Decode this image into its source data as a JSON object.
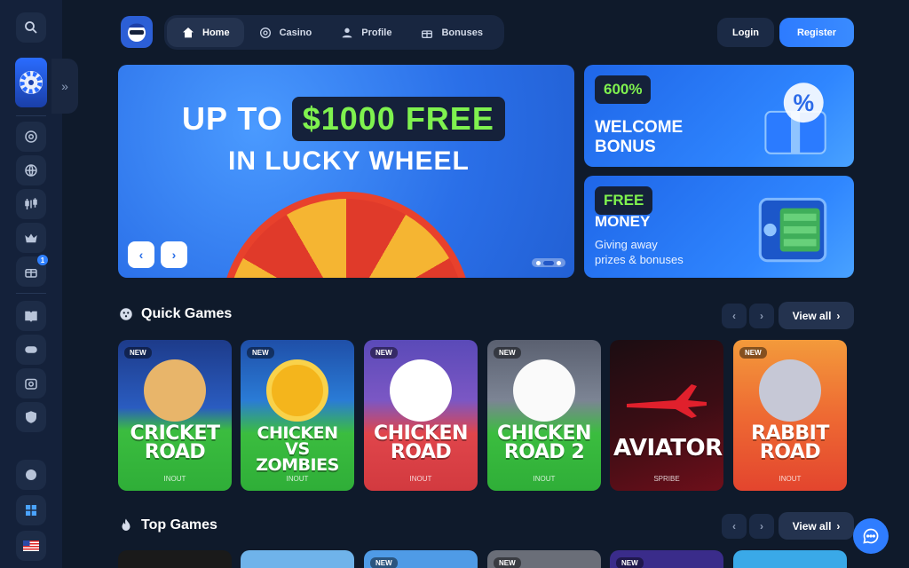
{
  "header": {
    "nav": [
      {
        "label": "Home",
        "icon": "home-icon",
        "active": true
      },
      {
        "label": "Casino",
        "icon": "casino-chip-icon",
        "active": false
      },
      {
        "label": "Profile",
        "icon": "user-icon",
        "active": false
      },
      {
        "label": "Bonuses",
        "icon": "gift-icon",
        "active": false
      }
    ],
    "login_label": "Login",
    "register_label": "Register"
  },
  "sidebar": {
    "notification_count": "1"
  },
  "hero": {
    "line1_prefix": "UP TO",
    "line1_highlight": "$1000 FREE",
    "line2": "IN LUCKY WHEEL"
  },
  "promos": [
    {
      "tag": "600%",
      "title_line1": "WELCOME",
      "title_line2": "BONUS"
    },
    {
      "tag": "FREE",
      "title_line1": "MONEY",
      "subtitle_line1": "Giving away",
      "subtitle_line2": "prizes & bonuses"
    }
  ],
  "quick_games": {
    "title": "Quick Games",
    "view_all": "View all",
    "games": [
      {
        "title_line1": "CRICKET",
        "title_line2": "ROAD",
        "provider": "INOUT",
        "new": "NEW"
      },
      {
        "title_line1": "CHICKEN",
        "title_line2": "VS ZOMBIES",
        "provider": "INOUT",
        "new": "NEW"
      },
      {
        "title_line1": "CHICKEN",
        "title_line2": "ROAD",
        "provider": "INOUT",
        "new": "NEW"
      },
      {
        "title_line1": "CHICKEN",
        "title_line2": "ROAD 2",
        "provider": "INOUT",
        "new": "NEW"
      },
      {
        "title_line1": "AVIATOR",
        "title_line2": "",
        "provider": "SPRIBE",
        "new": ""
      },
      {
        "title_line1": "RABBIT",
        "title_line2": "ROAD",
        "provider": "INOUT",
        "new": "NEW"
      }
    ]
  },
  "top_games": {
    "title": "Top Games",
    "view_all": "View all",
    "new_labels": [
      "NEW",
      "NEW",
      "NEW"
    ]
  },
  "colors": {
    "accent": "#2f7dff",
    "highlight": "#7ff24f",
    "background": "#0f1a2b"
  }
}
